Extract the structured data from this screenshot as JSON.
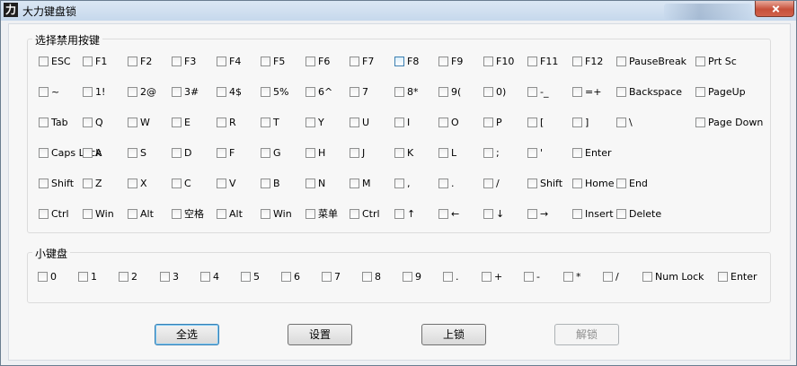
{
  "window": {
    "title": "大力键盘锁",
    "icon_glyph": "力"
  },
  "main_group": {
    "legend": "选择禁用按键",
    "rows": [
      [
        {
          "label": "ESC",
          "name": "esc"
        },
        {
          "label": "F1",
          "name": "f1"
        },
        {
          "label": "F2",
          "name": "f2"
        },
        {
          "label": "F3",
          "name": "f3"
        },
        {
          "label": "F4",
          "name": "f4"
        },
        {
          "label": "F5",
          "name": "f5"
        },
        {
          "label": "F6",
          "name": "f6"
        },
        {
          "label": "F7",
          "name": "f7"
        },
        {
          "label": "F8",
          "name": "f8",
          "hover": true
        },
        {
          "label": "F9",
          "name": "f9"
        },
        {
          "label": "F10",
          "name": "f10"
        },
        {
          "label": "F11",
          "name": "f11"
        },
        {
          "label": "F12",
          "name": "f12"
        },
        {
          "label": "PauseBreak",
          "name": "pausebreak"
        },
        {
          "label": "Prt Sc",
          "name": "prtsc"
        }
      ],
      [
        {
          "label": "~",
          "name": "tilde"
        },
        {
          "label": "1!",
          "name": "1"
        },
        {
          "label": "2@",
          "name": "2"
        },
        {
          "label": "3#",
          "name": "3"
        },
        {
          "label": "4$",
          "name": "4"
        },
        {
          "label": "5%",
          "name": "5"
        },
        {
          "label": "6^",
          "name": "6"
        },
        {
          "label": "7",
          "name": "7"
        },
        {
          "label": "8*",
          "name": "8"
        },
        {
          "label": "9(",
          "name": "9"
        },
        {
          "label": "0)",
          "name": "0"
        },
        {
          "label": "-_",
          "name": "minus"
        },
        {
          "label": "=+",
          "name": "equals"
        },
        {
          "label": "Backspace",
          "name": "backspace"
        },
        {
          "label": "PageUp",
          "name": "pageup"
        }
      ],
      [
        {
          "label": "Tab",
          "name": "tab"
        },
        {
          "label": "Q",
          "name": "q"
        },
        {
          "label": "W",
          "name": "w"
        },
        {
          "label": "E",
          "name": "e"
        },
        {
          "label": "R",
          "name": "r"
        },
        {
          "label": "T",
          "name": "t"
        },
        {
          "label": "Y",
          "name": "y"
        },
        {
          "label": "U",
          "name": "u"
        },
        {
          "label": "I",
          "name": "i"
        },
        {
          "label": "O",
          "name": "o"
        },
        {
          "label": "P",
          "name": "p"
        },
        {
          "label": "[",
          "name": "lbracket"
        },
        {
          "label": "]",
          "name": "rbracket"
        },
        {
          "label": "\\",
          "name": "backslash"
        },
        {
          "label": "Page Down",
          "name": "pagedown"
        }
      ],
      [
        {
          "label": "Caps Lock",
          "name": "capslock"
        },
        {
          "label": "A",
          "name": "a"
        },
        {
          "label": "S",
          "name": "s"
        },
        {
          "label": "D",
          "name": "d"
        },
        {
          "label": "F",
          "name": "f"
        },
        {
          "label": "G",
          "name": "g"
        },
        {
          "label": "H",
          "name": "h"
        },
        {
          "label": "J",
          "name": "j"
        },
        {
          "label": "K",
          "name": "k"
        },
        {
          "label": "L",
          "name": "l"
        },
        {
          "label": ";",
          "name": "semicolon"
        },
        {
          "label": "'",
          "name": "quote"
        },
        {
          "label": "Enter",
          "name": "enter"
        }
      ],
      [
        {
          "label": "Shift",
          "name": "lshift"
        },
        {
          "label": "Z",
          "name": "z"
        },
        {
          "label": "X",
          "name": "x"
        },
        {
          "label": "C",
          "name": "c"
        },
        {
          "label": "V",
          "name": "v"
        },
        {
          "label": "B",
          "name": "b"
        },
        {
          "label": "N",
          "name": "n"
        },
        {
          "label": "M",
          "name": "m"
        },
        {
          "label": ",",
          "name": "comma"
        },
        {
          "label": ".",
          "name": "period"
        },
        {
          "label": "/",
          "name": "slash"
        },
        {
          "label": "Shift",
          "name": "rshift"
        },
        {
          "label": "Home",
          "name": "home"
        },
        {
          "label": "End",
          "name": "end"
        }
      ],
      [
        {
          "label": "Ctrl",
          "name": "lctrl"
        },
        {
          "label": "Win",
          "name": "lwin"
        },
        {
          "label": "Alt",
          "name": "lalt"
        },
        {
          "label": "空格",
          "name": "space"
        },
        {
          "label": "Alt",
          "name": "ralt"
        },
        {
          "label": "Win",
          "name": "rwin"
        },
        {
          "label": "菜单",
          "name": "menu"
        },
        {
          "label": "Ctrl",
          "name": "rctrl"
        },
        {
          "label": "↑",
          "name": "up"
        },
        {
          "label": "←",
          "name": "left"
        },
        {
          "label": "↓",
          "name": "down"
        },
        {
          "label": "→",
          "name": "right"
        },
        {
          "label": "Insert",
          "name": "insert"
        },
        {
          "label": "Delete",
          "name": "delete"
        }
      ]
    ]
  },
  "numpad_group": {
    "legend": "小键盘",
    "keys": [
      {
        "label": "0",
        "name": "num0"
      },
      {
        "label": "1",
        "name": "num1"
      },
      {
        "label": "2",
        "name": "num2"
      },
      {
        "label": "3",
        "name": "num3"
      },
      {
        "label": "4",
        "name": "num4"
      },
      {
        "label": "5",
        "name": "num5"
      },
      {
        "label": "6",
        "name": "num6"
      },
      {
        "label": "7",
        "name": "num7"
      },
      {
        "label": "8",
        "name": "num8"
      },
      {
        "label": "9",
        "name": "num9"
      },
      {
        "label": ".",
        "name": "numdot"
      },
      {
        "label": "+",
        "name": "numplus"
      },
      {
        "label": "-",
        "name": "numminus"
      },
      {
        "label": "*",
        "name": "nummul"
      },
      {
        "label": "/",
        "name": "numdiv"
      },
      {
        "label": "Num Lock",
        "name": "numlock"
      },
      {
        "label": "Enter",
        "name": "numenter"
      }
    ]
  },
  "buttons": {
    "select_all": "全选",
    "settings": "设置",
    "lock": "上锁",
    "unlock": "解锁"
  }
}
